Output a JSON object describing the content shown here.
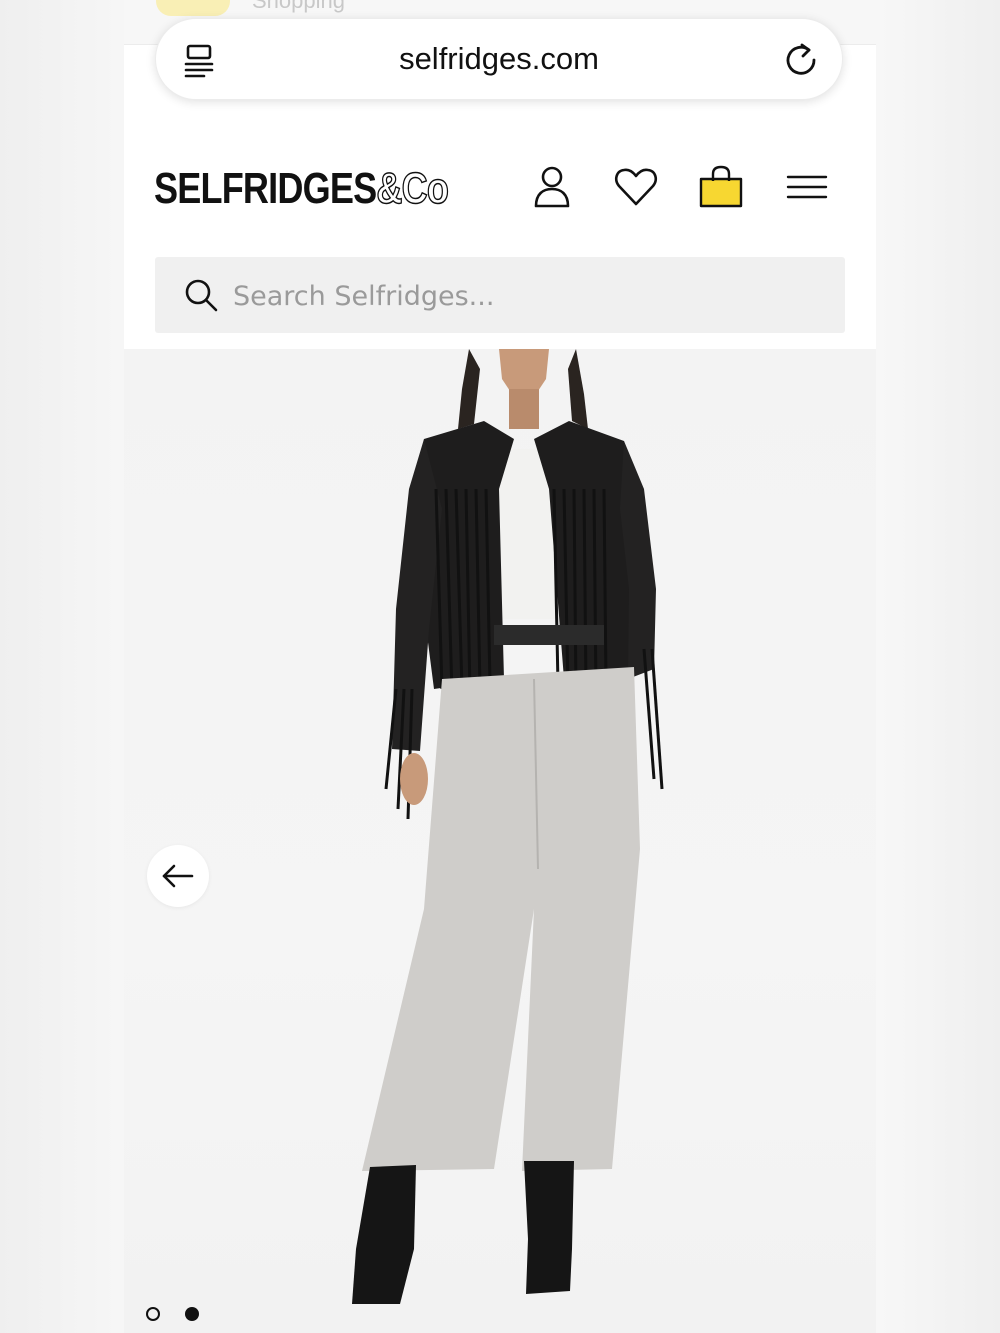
{
  "browser": {
    "previous_tab_label": "Shopping",
    "url": "selfridges.com",
    "icons": [
      "reader-mode-icon",
      "reload-icon"
    ]
  },
  "header": {
    "logo_text": "SELFRIDGES",
    "logo_suffix": "&Co",
    "icons": [
      "account-icon",
      "wishlist-heart-icon",
      "shopping-bag-icon",
      "menu-icon"
    ],
    "bag_color": "#f7d731"
  },
  "search": {
    "placeholder": "Search Selfridges..."
  },
  "gallery": {
    "image_subject": "model-fringe-leather-jacket",
    "nav": "previous-arrow-icon",
    "dots_total": 2,
    "active_dot": 2
  }
}
